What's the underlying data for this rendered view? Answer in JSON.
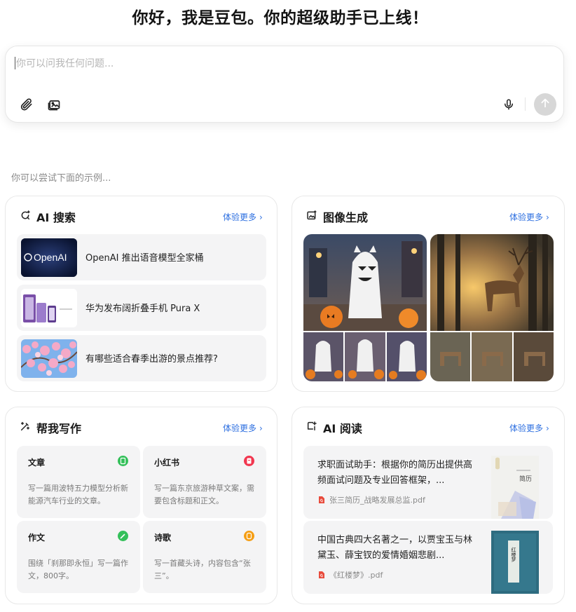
{
  "header": {
    "title": "你好，我是豆包。你的超级助手已上线！"
  },
  "composer": {
    "placeholder": "你可以问我任何问题...",
    "icons": [
      "paperclip-icon",
      "image-upload-icon",
      "microphone-icon",
      "send-arrow-icon"
    ]
  },
  "examples_label": "你可以尝试下面的示例...",
  "cards": {
    "search": {
      "title": "AI 搜索",
      "more": "体验更多",
      "items": [
        {
          "text": "OpenAI 推出语音模型全家桶",
          "thumb_text": "OpenAI"
        },
        {
          "text": "华为发布阔折叠手机 Pura X"
        },
        {
          "text": "有哪些适合春季出游的景点推荐?"
        }
      ]
    },
    "image": {
      "title": "图像生成",
      "more": "体验更多"
    },
    "writing": {
      "title": "帮我写作",
      "more": "体验更多",
      "items": [
        {
          "title": "文章",
          "desc": "写一篇用波特五力模型分析新能源汽车行业的文章。",
          "color": "#34c05a"
        },
        {
          "title": "小红书",
          "desc": "写一篇东京旅游种草文案，需要包含标题和正文。",
          "color": "#f1364f"
        },
        {
          "title": "作文",
          "desc": "围绕「刹那即永恒」写一篇作文，800字。",
          "color": "#34c05a"
        },
        {
          "title": "诗歌",
          "desc": "写一首藏头诗，内容包含“张三”。",
          "color": "#f59e14"
        }
      ]
    },
    "reading": {
      "title": "AI 阅读",
      "more": "体验更多",
      "items": [
        {
          "question": "求职面试助手：根据你的简历出提供高频面试问题及专业回答框架，...",
          "file": "张三简历_战略发展总监.pdf",
          "cover_text": "简历"
        },
        {
          "question": "中国古典四大名著之一，以贾宝玉与林黛玉、薛宝钗的爱情婚姻悲剧...",
          "file": "《红楼梦》.pdf",
          "cover_text": "红楼梦"
        }
      ]
    }
  },
  "colors": {
    "accent": "#2d6fe0",
    "card_bg": "#f4f4f5",
    "send_disabled": "#d7d7d7"
  }
}
